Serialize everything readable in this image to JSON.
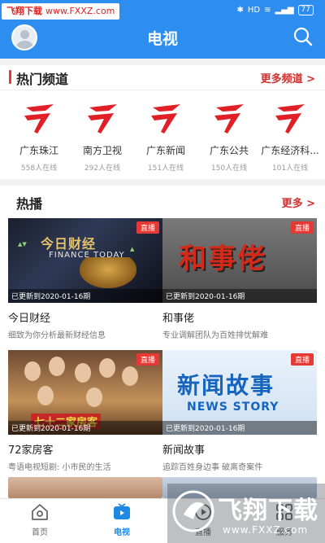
{
  "status_bar": {
    "watermark_text": "飞翔下载",
    "watermark_url": "www.FXXZ.com",
    "battery": "77"
  },
  "header": {
    "title": "电视"
  },
  "hot_channels": {
    "title": "热门频道",
    "more_label": "更多频道 >",
    "items": [
      {
        "name": "广东珠江",
        "viewers": "558人在线"
      },
      {
        "name": "南方卫视",
        "viewers": "292人在线"
      },
      {
        "name": "广东新闻",
        "viewers": "151人在线"
      },
      {
        "name": "广东公共",
        "viewers": "150人在线"
      },
      {
        "name": "广东经济科...",
        "viewers": "101人在线"
      }
    ]
  },
  "hot_play": {
    "title": "热播",
    "more_label": "更多 >",
    "cards": [
      {
        "title": "今日财经",
        "desc": "细致为你分析最新财经信息",
        "updated": "已更新到2020-01-16期",
        "live_tag": "直播",
        "art_title": "今日财经",
        "art_subtitle": "FINANCE TODAY"
      },
      {
        "title": "和事佬",
        "desc": "专业调解团队为百姓排忧解难",
        "updated": "已更新到2020-01-16期",
        "live_tag": "直播",
        "art_title": "和事佬"
      },
      {
        "title": "72家房客",
        "desc": "粤语电视短剧: 小市民的生活",
        "updated": "已更新到2020-01-16期",
        "live_tag": "直播",
        "art_title": "七十二家房客"
      },
      {
        "title": "新闻故事",
        "desc": "追踪百姓身边事 破离奇案件",
        "updated": "已更新到2020-01-16期",
        "live_tag": "直播",
        "art_title": "新闻故事",
        "art_subtitle": "NEWS STORY"
      }
    ]
  },
  "bottom_nav": {
    "items": [
      {
        "label": "首页",
        "icon": "home-icon"
      },
      {
        "label": "电视",
        "icon": "tv-icon",
        "active": true
      },
      {
        "label": "直播",
        "icon": "live-icon"
      },
      {
        "label": "服务",
        "icon": "service-icon"
      }
    ]
  },
  "watermark": {
    "text": "飞翔下载",
    "url": "www.FXXZ.com"
  },
  "colors": {
    "primary": "#2d8ef0",
    "accent_red": "#e53935",
    "active_tab": "#1e88e5"
  }
}
